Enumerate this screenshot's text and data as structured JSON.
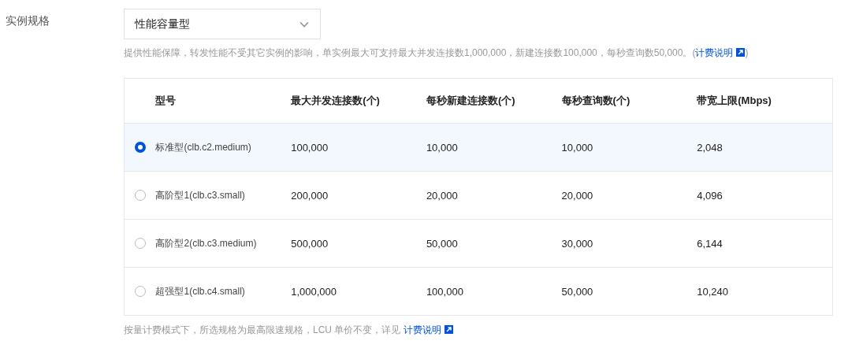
{
  "field_label": "实例规格",
  "select": {
    "value": "性能容量型"
  },
  "hint": {
    "text": "提供性能保障，转发性能不受其它实例的影响，单实例最大可支持最大并发连接数1,000,000，新建连接数100,000，每秒查询数50,000。(",
    "link": "计费说明",
    "after": ")"
  },
  "table": {
    "columns": [
      "型号",
      "最大并发连接数(个)",
      "每秒新建连接数(个)",
      "每秒查询数(个)",
      "带宽上限(Mbps)"
    ],
    "rows": [
      {
        "selected": true,
        "cells": [
          "标准型(clb.c2.medium)",
          "100,000",
          "10,000",
          "10,000",
          "2,048"
        ]
      },
      {
        "selected": false,
        "cells": [
          "高阶型1(clb.c3.small)",
          "200,000",
          "20,000",
          "20,000",
          "4,096"
        ]
      },
      {
        "selected": false,
        "cells": [
          "高阶型2(clb.c3.medium)",
          "500,000",
          "50,000",
          "30,000",
          "6,144"
        ]
      },
      {
        "selected": false,
        "cells": [
          "超强型1(clb.c4.small)",
          "1,000,000",
          "100,000",
          "50,000",
          "10,240"
        ]
      }
    ]
  },
  "footer": {
    "text": "按量计费模式下，所选规格为最高限速规格，LCU 单价不变，详见 ",
    "link": "计费说明"
  }
}
